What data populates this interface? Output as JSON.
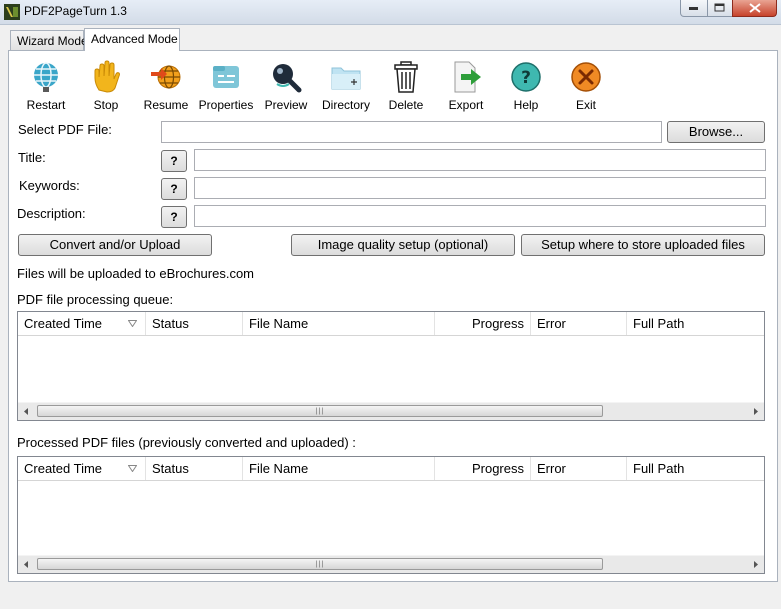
{
  "window": {
    "title": "PDF2PageTurn 1.3"
  },
  "tabs": [
    {
      "label": "Wizard Mode",
      "active": false
    },
    {
      "label": "Advanced Mode",
      "active": true
    }
  ],
  "toolbar": [
    {
      "label": "Restart",
      "icon": "globe-restart-icon"
    },
    {
      "label": "Stop",
      "icon": "hand-stop-icon"
    },
    {
      "label": "Resume",
      "icon": "resume-icon"
    },
    {
      "label": "Properties",
      "icon": "properties-icon"
    },
    {
      "label": "Preview",
      "icon": "preview-icon"
    },
    {
      "label": "Directory",
      "icon": "folder-icon"
    },
    {
      "label": "Delete",
      "icon": "trash-icon"
    },
    {
      "label": "Export",
      "icon": "export-icon"
    },
    {
      "label": "Help",
      "icon": "help-icon"
    },
    {
      "label": "Exit",
      "icon": "exit-icon"
    }
  ],
  "form": {
    "select_pdf_label": "Select PDF File:",
    "select_pdf_value": "",
    "browse_label": "Browse...",
    "title_label": "Title:",
    "title_value": "",
    "keywords_label": "Keywords:",
    "keywords_value": "",
    "description_label": "Description:",
    "description_value": "",
    "help_label": "?"
  },
  "actions": {
    "convert_label": "Convert and/or Upload",
    "image_quality_label": "Image quality setup (optional)",
    "storage_setup_label": "Setup where to store uploaded files"
  },
  "upload_info": "Files will be uploaded to eBrochures.com",
  "queue": {
    "heading": "PDF file processing queue:",
    "columns": [
      "Created Time",
      "Status",
      "File Name",
      "Progress",
      "Error",
      "Full Path"
    ],
    "rows": []
  },
  "processed": {
    "heading": "Processed PDF files (previously converted and uploaded) :",
    "columns": [
      "Created Time",
      "Status",
      "File Name",
      "Progress",
      "Error",
      "Full Path"
    ],
    "rows": []
  },
  "colors": {
    "accent_green": "#2e9e3a",
    "help_teal": "#3fb8b0",
    "exit_orange": "#f08a24"
  }
}
